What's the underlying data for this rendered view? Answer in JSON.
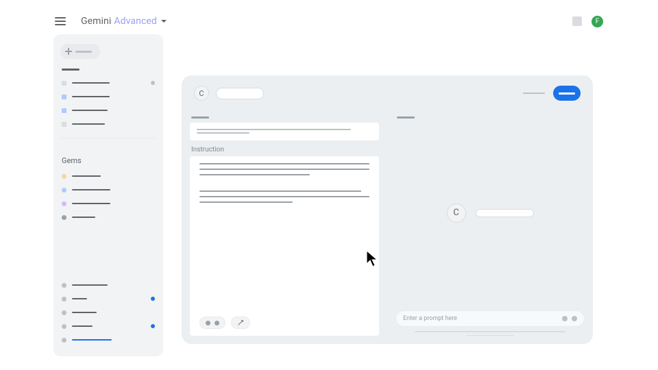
{
  "header": {
    "brand_primary": "Gemini",
    "brand_secondary": "Advanced",
    "avatar_letter": "F"
  },
  "sidebar": {
    "gems_heading": "Gems"
  },
  "editor": {
    "instruction_label": "Instruction",
    "gem_letter": "C"
  },
  "preview": {
    "gem_letter": "C",
    "prompt_placeholder": "Enter a prompt here"
  },
  "colors": {
    "conv_icons": [
      "#dadce0",
      "#aecbfa",
      "#aecbfa",
      "#dadce0"
    ],
    "gem_dots": [
      "#fad2a5",
      "#aecbfa",
      "#d7b8fb",
      "#9aa0a6"
    ],
    "badge_blue": "#1a73e8"
  }
}
